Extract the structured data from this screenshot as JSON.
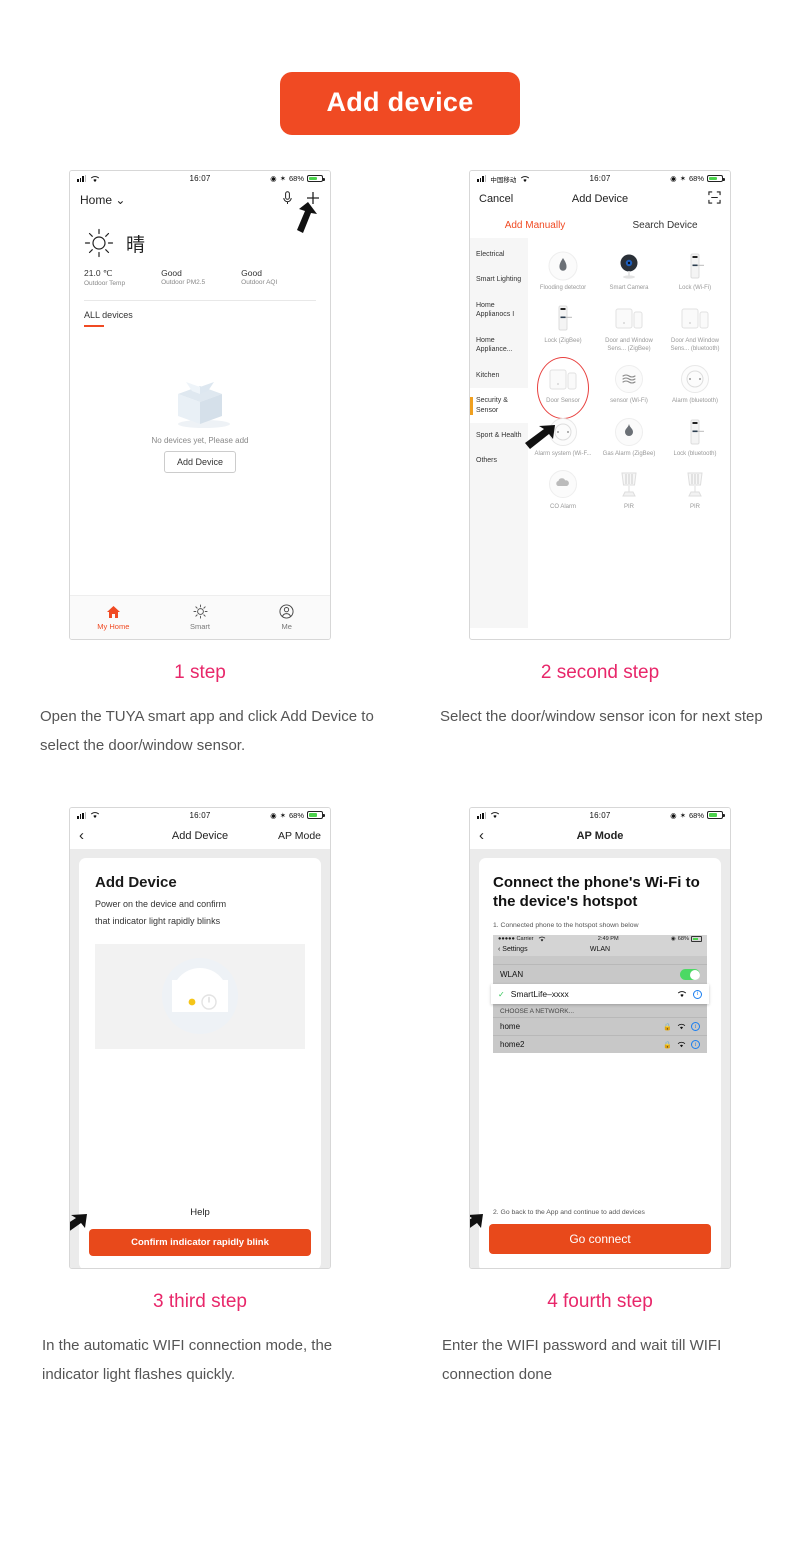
{
  "header": {
    "badge": "Add device"
  },
  "steps": [
    {
      "title": "1 step",
      "body": "Open the TUYA smart app and click Add Device to select the door/window sensor."
    },
    {
      "title": "2 second step",
      "body": "Select the door/window sensor icon for next step"
    },
    {
      "title": "3 third step",
      "body": "In the automatic WIFI connection mode, the indicator light flashes quickly."
    },
    {
      "title": "4 fourth step",
      "body": "Enter the WIFI password and wait till WIFI connection done"
    }
  ],
  "phone1": {
    "status": {
      "carrier": "",
      "time": "16:07",
      "battery": "68%"
    },
    "home_label": "Home",
    "chevron": "⌄",
    "weather_condition": "晴",
    "metrics": [
      {
        "value": "21.0 ℃",
        "label": "Outdoor Temp"
      },
      {
        "value": "Good",
        "label": "Outdoor PM2.5"
      },
      {
        "value": "Good",
        "label": "Outdoor AQI"
      }
    ],
    "all_devices": "ALL devices",
    "empty_text": "No devices yet, Please add",
    "add_device_button": "Add Device",
    "tabs": [
      {
        "label": "My Home",
        "icon": "home-icon",
        "active": true
      },
      {
        "label": "Smart",
        "icon": "sun-icon",
        "active": false
      },
      {
        "label": "Me",
        "icon": "person-icon",
        "active": false
      }
    ]
  },
  "phone2": {
    "status": {
      "carrier": "中国移动",
      "time": "16:07",
      "battery": "68%"
    },
    "nav": {
      "cancel": "Cancel",
      "title": "Add Device",
      "scan_icon": "scan-icon"
    },
    "tabs": [
      {
        "label": "Add Manually",
        "active": true
      },
      {
        "label": "Search Device",
        "active": false
      }
    ],
    "categories": [
      {
        "label": "Electrical",
        "active": false
      },
      {
        "label": "Smart Lighting",
        "active": false
      },
      {
        "label": "Home Applianocs I",
        "active": false
      },
      {
        "label": "Home Appliance...",
        "active": false
      },
      {
        "label": "Kitchen",
        "active": false
      },
      {
        "label": "Security & Sensor",
        "active": true
      },
      {
        "label": "Sport & Health",
        "active": false
      },
      {
        "label": "Others",
        "active": false
      }
    ],
    "devices": [
      {
        "label": "Flooding detector",
        "icon": "water-drop-icon",
        "highlighted": false
      },
      {
        "label": "Smart Camera",
        "icon": "camera-icon",
        "highlighted": false
      },
      {
        "label": "Lock (Wi-Fi)",
        "icon": "lock-icon",
        "highlighted": false
      },
      {
        "label": "Lock (ZigBee)",
        "icon": "lock-icon",
        "highlighted": false
      },
      {
        "label": "Door and Window Sens... (ZigBee)",
        "icon": "door-sensor-icon",
        "highlighted": false
      },
      {
        "label": "Door And Window Sens... (bluetooth)",
        "icon": "door-sensor-icon",
        "highlighted": false
      },
      {
        "label": "Door Sensor",
        "icon": "door-sensor-icon",
        "highlighted": true
      },
      {
        "label": "sensor (Wi-Fi)",
        "icon": "motion-sensor-icon",
        "highlighted": false
      },
      {
        "label": "Alarm (bluetooth)",
        "icon": "alarm-icon",
        "highlighted": false
      },
      {
        "label": "Alarm system (Wi-F...",
        "icon": "alarm-icon",
        "highlighted": false
      },
      {
        "label": "Gas Alarm (ZigBee)",
        "icon": "flame-icon",
        "highlighted": false
      },
      {
        "label": "Lock (bluetooth)",
        "icon": "lock-icon",
        "highlighted": false
      },
      {
        "label": "CO Alarm",
        "icon": "co-alarm-icon",
        "highlighted": false
      },
      {
        "label": "PIR",
        "icon": "pir-icon",
        "highlighted": false
      },
      {
        "label": "PIR",
        "icon": "pir-icon",
        "highlighted": false
      }
    ]
  },
  "phone3": {
    "status": {
      "time": "16:07",
      "battery": "68%"
    },
    "nav": {
      "back": "‹",
      "title": "Add Device",
      "right": "AP Mode"
    },
    "card_title": "Add Device",
    "card_line1": "Power on the device and confirm",
    "card_line2": "that indicator light rapidly blinks",
    "help": "Help",
    "cta": "Confirm indicator rapidly blink"
  },
  "phone4": {
    "status": {
      "time": "16:07",
      "battery": "68%"
    },
    "nav": {
      "back": "‹",
      "title": "AP Mode"
    },
    "card_title": "Connect the phone's Wi-Fi to the device's hotspot",
    "note1": "1. Connected phone to the hotspot shown below",
    "note2": "2. Go back to the App and continue to add devices",
    "cta": "Go connect",
    "wlan": {
      "status": {
        "carrier": "Carrier",
        "time": "2:49 PM",
        "battery": "68%"
      },
      "back": "Settings",
      "title": "WLAN",
      "toggle_row": "WLAN",
      "selected_network": "SmartLife–xxxx",
      "choose_header": "CHOOSE A NETWORK...",
      "networks": [
        "home",
        "home2"
      ]
    }
  },
  "colors": {
    "accent_orange": "#f04a23",
    "cta_orange": "#e8491b",
    "caption_pink": "#e8276a",
    "highlight_red": "#e8413f",
    "toggle_green": "#4cd964"
  }
}
